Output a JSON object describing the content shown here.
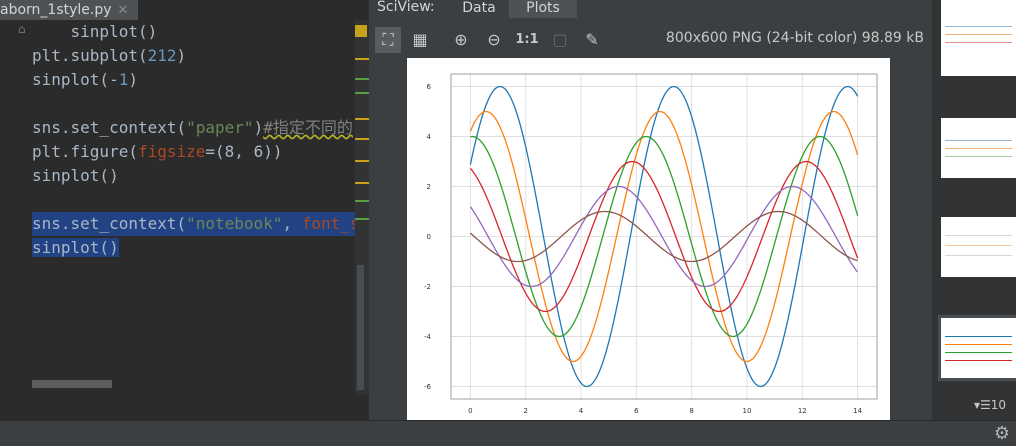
{
  "editor": {
    "tab_title": "aborn_1style.py",
    "lines": [
      {
        "text": "    sinplot()"
      },
      {
        "text": "plt.subplot(",
        "num": "212",
        "tail": ")"
      },
      {
        "text": "sinplot(-",
        "num": "1",
        "tail": ")"
      },
      {
        "text": ""
      },
      {
        "pre": "sns.set_context(",
        "str": "\"paper\"",
        "tail": ")",
        "cmt": "#指定不同的"
      },
      {
        "pre": "plt.figure(",
        "kw": "figsize",
        "tail": "=(8, 6))"
      },
      {
        "text": "sinplot()"
      },
      {
        "text": ""
      },
      {
        "pre": "sns.set_context(",
        "str": "\"notebook\"",
        "tail": ", ",
        "kw": "font_s"
      },
      {
        "text": "sinplot()"
      }
    ]
  },
  "sciview": {
    "title": "SciView:",
    "tabs": [
      "Data",
      "Plots"
    ],
    "image_info": "800x600 PNG (24-bit color) 98.89 kB",
    "toolbar": {
      "actual_size_label": "1:1"
    }
  },
  "thumbnails": {
    "count_label": "▾☰10"
  },
  "chart_data": {
    "type": "line",
    "xlim": [
      -0.7,
      14.7
    ],
    "ylim": [
      -6.5,
      6.5
    ],
    "x_ticks": [
      0,
      2,
      4,
      6,
      8,
      10,
      12,
      14
    ],
    "y_ticks": [
      6,
      4,
      2,
      0,
      -2,
      -4,
      -6
    ],
    "grid": true,
    "series": [
      {
        "color": "#1f77b4",
        "amplitude": 6,
        "phase": 0.5
      },
      {
        "color": "#ff7f0e",
        "amplitude": 5,
        "phase": 1.0
      },
      {
        "color": "#2ca02c",
        "amplitude": 4,
        "phase": 1.5
      },
      {
        "color": "#d62728",
        "amplitude": 3,
        "phase": 2.0
      },
      {
        "color": "#9467bd",
        "amplitude": 2,
        "phase": 2.5
      },
      {
        "color": "#8c564b",
        "amplitude": 1,
        "phase": 3.0
      }
    ]
  }
}
